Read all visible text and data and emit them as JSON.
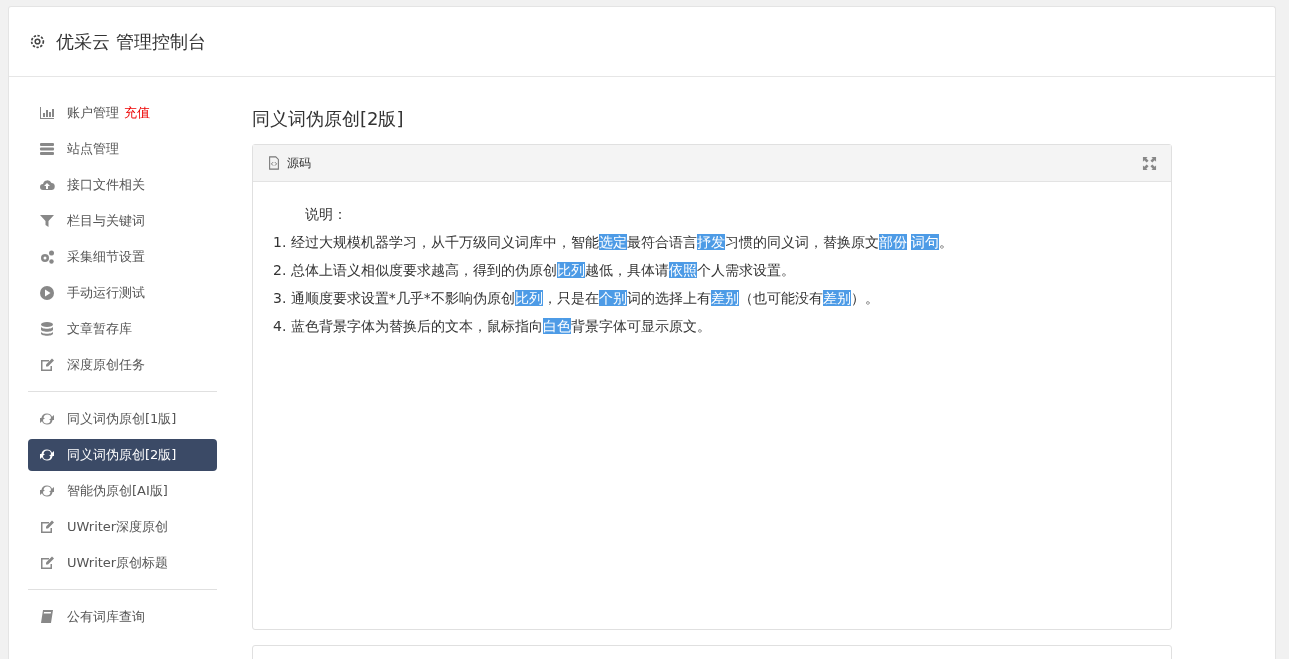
{
  "header": {
    "title": "优采云 管理控制台"
  },
  "sidebar": {
    "groups": [
      {
        "items": [
          {
            "label": "账户管理",
            "badge": "充值",
            "selected": false
          },
          {
            "label": "站点管理",
            "selected": false
          },
          {
            "label": "接口文件相关",
            "selected": false
          },
          {
            "label": "栏目与关键词",
            "selected": false
          },
          {
            "label": "采集细节设置",
            "selected": false
          },
          {
            "label": "手动运行测试",
            "selected": false
          },
          {
            "label": "文章暂存库",
            "selected": false
          },
          {
            "label": "深度原创任务",
            "selected": false
          }
        ]
      },
      {
        "items": [
          {
            "label": "同义词伪原创[1版]",
            "selected": false
          },
          {
            "label": "同义词伪原创[2版]",
            "selected": true
          },
          {
            "label": "智能伪原创[AI版]",
            "selected": false
          },
          {
            "label": "UWriter深度原创",
            "selected": false
          },
          {
            "label": "UWriter原创标题",
            "selected": false
          }
        ]
      },
      {
        "items": [
          {
            "label": "公有词库查询",
            "selected": false
          }
        ]
      }
    ]
  },
  "page": {
    "title": "同义词伪原创[2版]"
  },
  "editor": {
    "toolbar": {
      "source_button": "源码"
    },
    "lines": [
      {
        "kind": "heading",
        "segments": [
          {
            "text": "说明：",
            "highlighted": false
          }
        ]
      },
      {
        "kind": "item",
        "segments": [
          {
            "text": "1. 经过大规模机器学习，从千万级同义词库中，智能",
            "highlighted": false
          },
          {
            "text": "选定",
            "highlighted": true
          },
          {
            "text": "最符合语言",
            "highlighted": false
          },
          {
            "text": "抒发",
            "highlighted": true
          },
          {
            "text": "习惯的同义词，替换原文",
            "highlighted": false
          },
          {
            "text": "部份",
            "highlighted": true
          },
          {
            "text": "词句",
            "highlighted": true
          },
          {
            "text": "。",
            "highlighted": false
          }
        ]
      },
      {
        "kind": "item",
        "segments": [
          {
            "text": "2. 总体上语义相似度要求越高，得到的伪原创",
            "highlighted": false
          },
          {
            "text": "比列",
            "highlighted": true
          },
          {
            "text": "越低，具体请",
            "highlighted": false
          },
          {
            "text": "依照",
            "highlighted": true
          },
          {
            "text": "个人需求设置。",
            "highlighted": false
          }
        ]
      },
      {
        "kind": "item",
        "segments": [
          {
            "text": "3. 通顺度要求设置*几乎*不影响伪原创",
            "highlighted": false
          },
          {
            "text": "比列",
            "highlighted": true
          },
          {
            "text": "，只是在",
            "highlighted": false
          },
          {
            "text": "个别",
            "highlighted": true
          },
          {
            "text": "词的选择上有",
            "highlighted": false
          },
          {
            "text": "差别",
            "highlighted": true
          },
          {
            "text": "（也可能没有",
            "highlighted": false
          },
          {
            "text": "差别",
            "highlighted": true
          },
          {
            "text": "）。",
            "highlighted": false
          }
        ]
      },
      {
        "kind": "item",
        "segments": [
          {
            "text": "4. 蓝色背景字体为替换后的文本，鼠标指向",
            "highlighted": false
          },
          {
            "text": "白色",
            "highlighted": true
          },
          {
            "text": "背景字体可显示原文。",
            "highlighted": false
          }
        ]
      }
    ]
  }
}
